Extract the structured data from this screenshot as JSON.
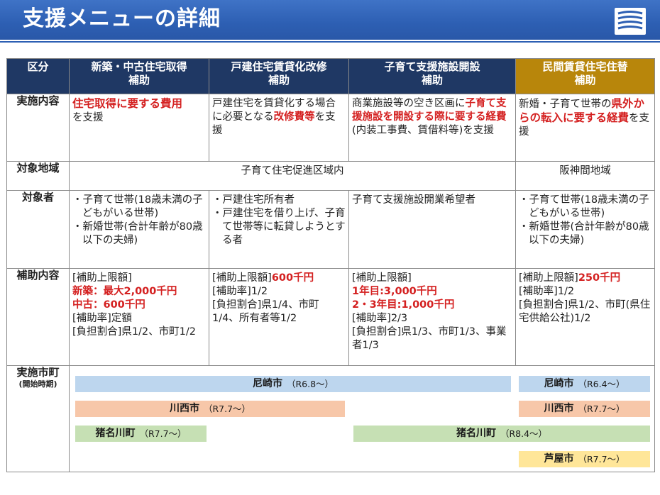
{
  "header": {
    "title": "支援メニューの詳細"
  },
  "table": {
    "columns": {
      "category": "区分",
      "c1": {
        "line1": "新築・中古住宅取得",
        "line2": "補助"
      },
      "c2": {
        "line1": "戸建住宅賃貸化改修",
        "line2": "補助"
      },
      "c3": {
        "line1": "子育て支援施設開設",
        "line2": "補助"
      },
      "c4": {
        "line1": "民間賃貸住宅住替",
        "line2": "補助"
      }
    },
    "rows": {
      "content": {
        "label": "実施内容",
        "c1": {
          "t1": "住宅取得に要する費用",
          "t2": "を支援"
        },
        "c2": {
          "t1": "戸建住宅を賃貸化する場合に必要となる",
          "t2": "改修費等",
          "t3": "を支援"
        },
        "c3": {
          "t1": "商業施設等の空き区画に",
          "t2": "子育て支援施設を開設する際に要する経費",
          "t3": "(内装工事費、賃借料等)を支援"
        },
        "c4": {
          "t1": "新婚・子育て世帯の",
          "t2": "県外からの転入に要する経費",
          "t3": "を支援"
        }
      },
      "area": {
        "label": "対象地域",
        "c1_3": "子育て住宅促進区域内",
        "c4": "阪神間地域"
      },
      "target": {
        "label": "対象者",
        "c1": [
          "子育て世帯(18歳未満の子どもがいる世帯)",
          "新婚世帯(合計年齢が80歳以下の夫婦)"
        ],
        "c2": [
          "戸建住宅所有者",
          "戸建住宅を借り上げ、子育て世帯等に転貸しようとする者"
        ],
        "c3": "子育て支援施設開業希望者",
        "c4": [
          "子育て世帯(18歳未満の子どもがいる世帯)",
          "新婚世帯(合計年齢が80歳以下の夫婦)"
        ]
      },
      "subsidy": {
        "label": "補助内容",
        "c1": {
          "l1": "[補助上限額]",
          "l2": "新築：最大2,000千円",
          "l3": "中古：600千円",
          "l4": "[補助率]定額",
          "l5": "[負担割合]県1/2、市町1/2"
        },
        "c2": {
          "l1a": "[補助上限額]",
          "l1b": "600千円",
          "l2": "[補助率]1/2",
          "l3": "[負担割合]県1/4、市町1/4、所有者等1/2"
        },
        "c3": {
          "l1": "[補助上限額]",
          "l2": "1年目:3,000千円",
          "l3": "2・3年目:1,000千円",
          "l4": "[補助率]2/3",
          "l5": "[負担割合]県1/3、市町1/3、事業者1/3"
        },
        "c4": {
          "l1a": "[補助上限額]",
          "l1b": "250千円",
          "l2": "[補助率]1/2",
          "l3": "[負担割合]県1/2、市町(県住宅供給公社)1/2"
        }
      },
      "implementation": {
        "label": "実施市町",
        "sublabel": "(開始時期)",
        "bars": {
          "amagasaki_main": {
            "name": "尼崎市",
            "period": "（R6.8～）"
          },
          "amagasaki_c4": {
            "name": "尼崎市",
            "period": "（R6.4～）"
          },
          "kawanishi_main": {
            "name": "川西市",
            "period": "（R7.7～）"
          },
          "kawanishi_c4": {
            "name": "川西市",
            "period": "（R7.7～）"
          },
          "inagawa_c1": {
            "name": "猪名川町",
            "period": "（R7.7～）"
          },
          "inagawa_c3_4": {
            "name": "猪名川町",
            "period": "（R8.4～）"
          },
          "ashiya_c4": {
            "name": "芦屋市",
            "period": "（R7.7～）"
          }
        }
      }
    }
  }
}
